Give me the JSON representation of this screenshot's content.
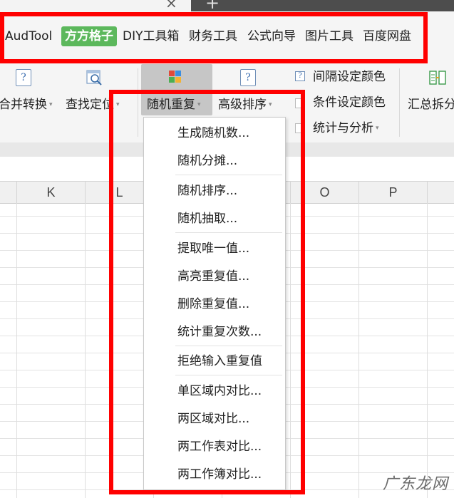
{
  "window": {
    "close_glyph": "×",
    "new_tab_glyph": "+"
  },
  "ribbon_tabs": [
    {
      "label": "AudTool"
    },
    {
      "label": "方方格子"
    },
    {
      "label": "DIY工具箱"
    },
    {
      "label": "财务工具"
    },
    {
      "label": "公式向导"
    },
    {
      "label": "图片工具"
    },
    {
      "label": "百度网盘"
    }
  ],
  "ribbon": {
    "merge_convert": {
      "label": "合并转换",
      "icon_glyph": "?"
    },
    "find_locate": {
      "label": "查找定位"
    },
    "random_repeat": {
      "label": "随机重复"
    },
    "advanced_sort": {
      "label": "高级排序",
      "icon_glyph": "?"
    },
    "interval_color": {
      "label": "间隔设定颜色",
      "icon_glyph": "?"
    },
    "conditional_color": {
      "label": "条件设定颜色"
    },
    "stats_analysis": {
      "label": "统计与分析"
    },
    "summary_split": {
      "label": "汇总拆分"
    },
    "caret": "▾"
  },
  "columns": [
    "K",
    "L",
    "O",
    "P"
  ],
  "menu": {
    "items": [
      {
        "label": "生成随机数..."
      },
      {
        "label": "随机分摊..."
      },
      {
        "label": "随机排序..."
      },
      {
        "label": "随机抽取..."
      },
      {
        "label": "提取唯一值..."
      },
      {
        "label": "高亮重复值..."
      },
      {
        "label": "删除重复值..."
      },
      {
        "label": "统计重复次数..."
      },
      {
        "label": "拒绝输入重复值"
      },
      {
        "label": "单区域内对比..."
      },
      {
        "label": "两区域对比..."
      },
      {
        "label": "两工作表对比..."
      },
      {
        "label": "两工作簿对比..."
      }
    ]
  },
  "watermark": "广东龙网",
  "colors": {
    "accent_green": "#5cb85c",
    "highlight_red": "#ff0000",
    "selected_button": "#c6c6c6"
  }
}
